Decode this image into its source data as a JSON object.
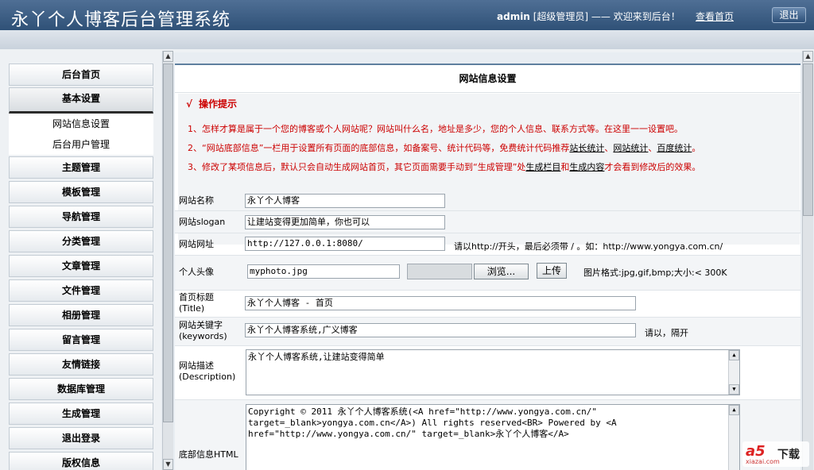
{
  "header": {
    "title": "永丫个人博客后台管理系统",
    "user_name": "admin",
    "user_role": "[超级管理员]",
    "welcome": "—— 欢迎来到后台！",
    "home_link": "查看首页",
    "logout": "退出"
  },
  "sidebar": {
    "items": [
      {
        "label": "后台首页"
      },
      {
        "label": "基本设置"
      },
      {
        "label": "主题管理"
      },
      {
        "label": "模板管理"
      },
      {
        "label": "导航管理"
      },
      {
        "label": "分类管理"
      },
      {
        "label": "文章管理"
      },
      {
        "label": "文件管理"
      },
      {
        "label": "相册管理"
      },
      {
        "label": "留言管理"
      },
      {
        "label": "友情链接"
      },
      {
        "label": "数据库管理"
      },
      {
        "label": "生成管理"
      },
      {
        "label": "退出登录"
      },
      {
        "label": "版权信息"
      }
    ],
    "subitems": [
      {
        "label": "网站信息设置"
      },
      {
        "label": "后台用户管理"
      }
    ]
  },
  "main": {
    "heading": "网站信息设置",
    "tips": {
      "title": "操作提示",
      "check_icon": "√",
      "line1": "1、怎样才算是属于一个您的博客或个人网站呢？网站叫什么名，地址是多少，您的个人信息、联系方式等。在这里一一设置吧。",
      "line2_a": "2、“网站底部信息”一栏用于设置所有页面的底部信息，如备案号、统计代码等，免费统计代码推荐",
      "line2_link1": "站长统计",
      "line2_sep1": "、",
      "line2_link2": "网站统计",
      "line2_sep2": "、",
      "line2_link3": "百度统计",
      "line2_end": "。",
      "line3_a": "3、修改了某项信息后，默认只会自动生成网站首页，其它页面需要手动到“生成管理”处",
      "line3_link1": "生成栏目",
      "line3_mid": "和",
      "line3_link2": "生成内容",
      "line3_end": "才会看到修改后的效果。"
    },
    "form": {
      "site_name_label": "网站名称",
      "site_name_value": "永丫个人博客",
      "slogan_label": "网站slogan",
      "slogan_value": "让建站变得更加简单，你也可以",
      "url_label": "网站网址",
      "url_value": "http://127.0.0.1:8080/",
      "url_hint": "请以http://开头，最后必须带 / 。如：http://www.yongya.com.cn/",
      "avatar_label": "个人头像",
      "avatar_value": "myphoto.jpg",
      "browse_label": "浏览...",
      "upload_label": "上传",
      "avatar_hint": "图片格式:jpg,gif,bmp;大小:< 300K",
      "home_title_label1": "首页标题",
      "home_title_label2": "(Title)",
      "home_title_value": "永丫个人博客 - 首页",
      "keywords_label1": "网站关键字",
      "keywords_label2": "(keywords)",
      "keywords_value": "永丫个人博客系统,广义博客",
      "keywords_hint": "请以，隔开",
      "desc_label1": "网站描述",
      "desc_label2": "(Description)",
      "desc_value": "永丫个人博客系统,让建站变得简单",
      "footer_label": "底部信息HTML",
      "footer_line1": "Copyright © 2011 永丫个人博客系统(<A href=\"http://www.yongya.com.cn/\"",
      "footer_line2": "target=_blank>yongya.com.cn</A>) All rights reserved<BR> Powered by <A",
      "footer_line3": "href=\"http://www.yongya.com.cn/\" target=_blank>永丫个人博客</A>"
    }
  },
  "watermark": {
    "logo": "a5",
    "download": "下载",
    "site": "xiazai.com"
  }
}
